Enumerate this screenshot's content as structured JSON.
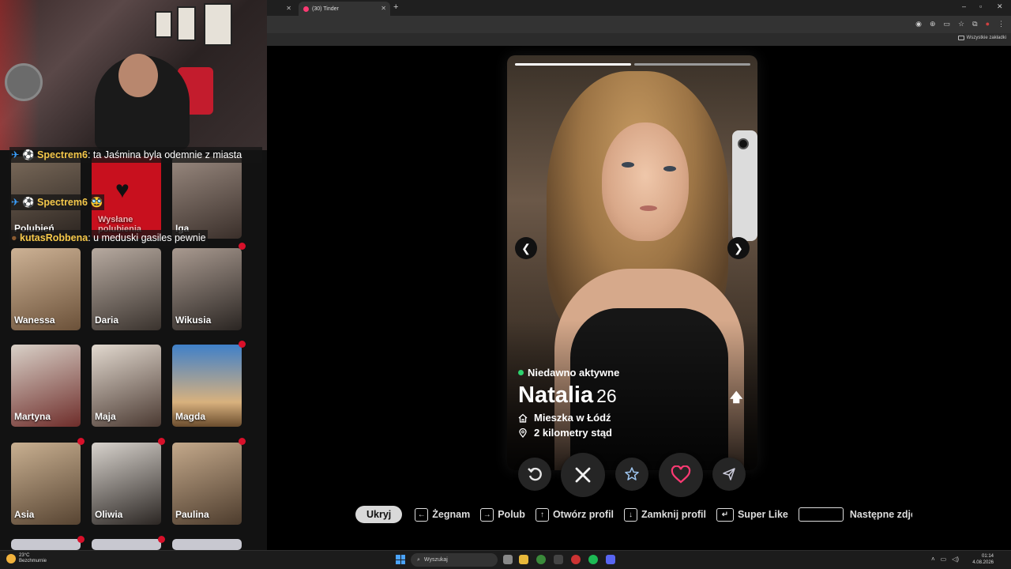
{
  "browser": {
    "tabs": [
      {
        "label": ""
      },
      {
        "label": "(30) Tinder"
      }
    ],
    "new_tab": "+",
    "window_controls": [
      "–",
      "▫",
      "✕"
    ],
    "bookmarks_label": "Wszystkie zakładki"
  },
  "chat": {
    "messages": [
      {
        "user": "Spectrem6",
        "text": ": ta Jaśmina byla odemnie z miasta"
      },
      {
        "user": "Spectrem6",
        "text": ""
      },
      {
        "user": "kutasRobbena",
        "text": ": u meduski gasiles pewnie"
      }
    ]
  },
  "grid": {
    "top_row": [
      {
        "name": "Polubień"
      },
      {
        "name": "Wysłane polubienia"
      },
      {
        "name": "Iga"
      }
    ],
    "cards": [
      {
        "name": "Wanessa"
      },
      {
        "name": "Daria"
      },
      {
        "name": "Wikusia"
      },
      {
        "name": "Martyna"
      },
      {
        "name": "Maja"
      },
      {
        "name": "Magda"
      },
      {
        "name": "Asia"
      },
      {
        "name": "Oliwia"
      },
      {
        "name": "Paulina"
      }
    ]
  },
  "profile": {
    "status": "Niedawno aktywne",
    "name": "Natalia",
    "age": "26",
    "lives": "Mieszka w Łódź",
    "distance": "2 kilometry stąd",
    "photos_total": 2,
    "photo_current": 1
  },
  "hints": {
    "hide": "Ukryj",
    "nope": "Żegnam",
    "like": "Polub",
    "open": "Otwórz profil",
    "close": "Zamknij profil",
    "superlike": "Super Like",
    "next": "Następne zdjęcie"
  },
  "taskbar": {
    "temp": "23°C",
    "weather": "Bezchmurnie",
    "search": "Wyszukaj",
    "time": "01:14",
    "date": "4.08.2026"
  },
  "colors": {
    "like": "#fd3a73",
    "superlike": "#3aa0ff",
    "rewind": "#f0b23c",
    "active": "#2dd36f"
  }
}
